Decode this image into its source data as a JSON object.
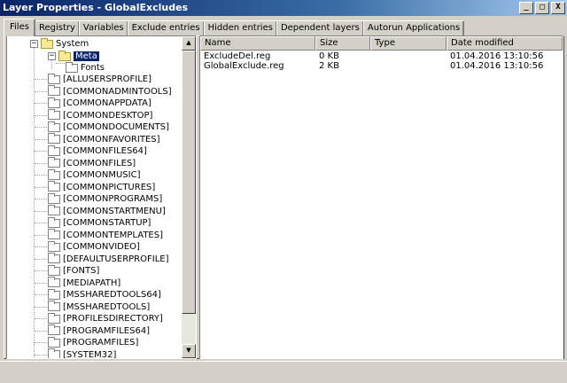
{
  "window": {
    "title": "Layer Properties - GlobalExcludes",
    "buttons": [
      {
        "name": "minimize-button",
        "glyph": "_"
      },
      {
        "name": "maximize-button",
        "glyph": "□"
      },
      {
        "name": "close-button",
        "glyph": "X"
      }
    ]
  },
  "tabs": [
    "Files",
    "Registry",
    "Variables",
    "Exclude entries",
    "Hidden entries",
    "Dependent layers",
    "Autorun Applications"
  ],
  "active_tab": "Files",
  "tree": {
    "root": {
      "label": "System",
      "expander": "−"
    },
    "selected": {
      "label": "Meta",
      "expander": "−"
    },
    "child": {
      "label": "Fonts"
    },
    "folders": [
      "[ALLUSERSPROFILE]",
      "[COMMONADMINTOOLS]",
      "[COMMONAPPDATA]",
      "[COMMONDESKTOP]",
      "[COMMONDOCUMENTS]",
      "[COMMONFAVORITES]",
      "[COMMONFILES64]",
      "[COMMONFILES]",
      "[COMMONMUSIC]",
      "[COMMONPICTURES]",
      "[COMMONPROGRAMS]",
      "[COMMONSTARTMENU]",
      "[COMMONSTARTUP]",
      "[COMMONTEMPLATES]",
      "[COMMONVIDEO]",
      "[DEFAULTUSERPROFILE]",
      "[FONTS]",
      "[MEDIAPATH]",
      "[MSSHAREDTOOLS64]",
      "[MSSHAREDTOOLS]",
      "[PROFILESDIRECTORY]",
      "[PROGRAMFILES64]",
      "[PROGRAMFILES]",
      "[SYSTEM32]"
    ]
  },
  "file_list": {
    "columns": [
      "Name",
      "Size",
      "Type",
      "Date modified"
    ],
    "rows": [
      {
        "name": "ExcludeDel.reg",
        "size": "0 KB",
        "type": "",
        "date": "01.04.2016 13:10:56"
      },
      {
        "name": "GlobalExclude.reg",
        "size": "2 KB",
        "type": "",
        "date": "01.04.2016 13:10:56"
      }
    ]
  }
}
